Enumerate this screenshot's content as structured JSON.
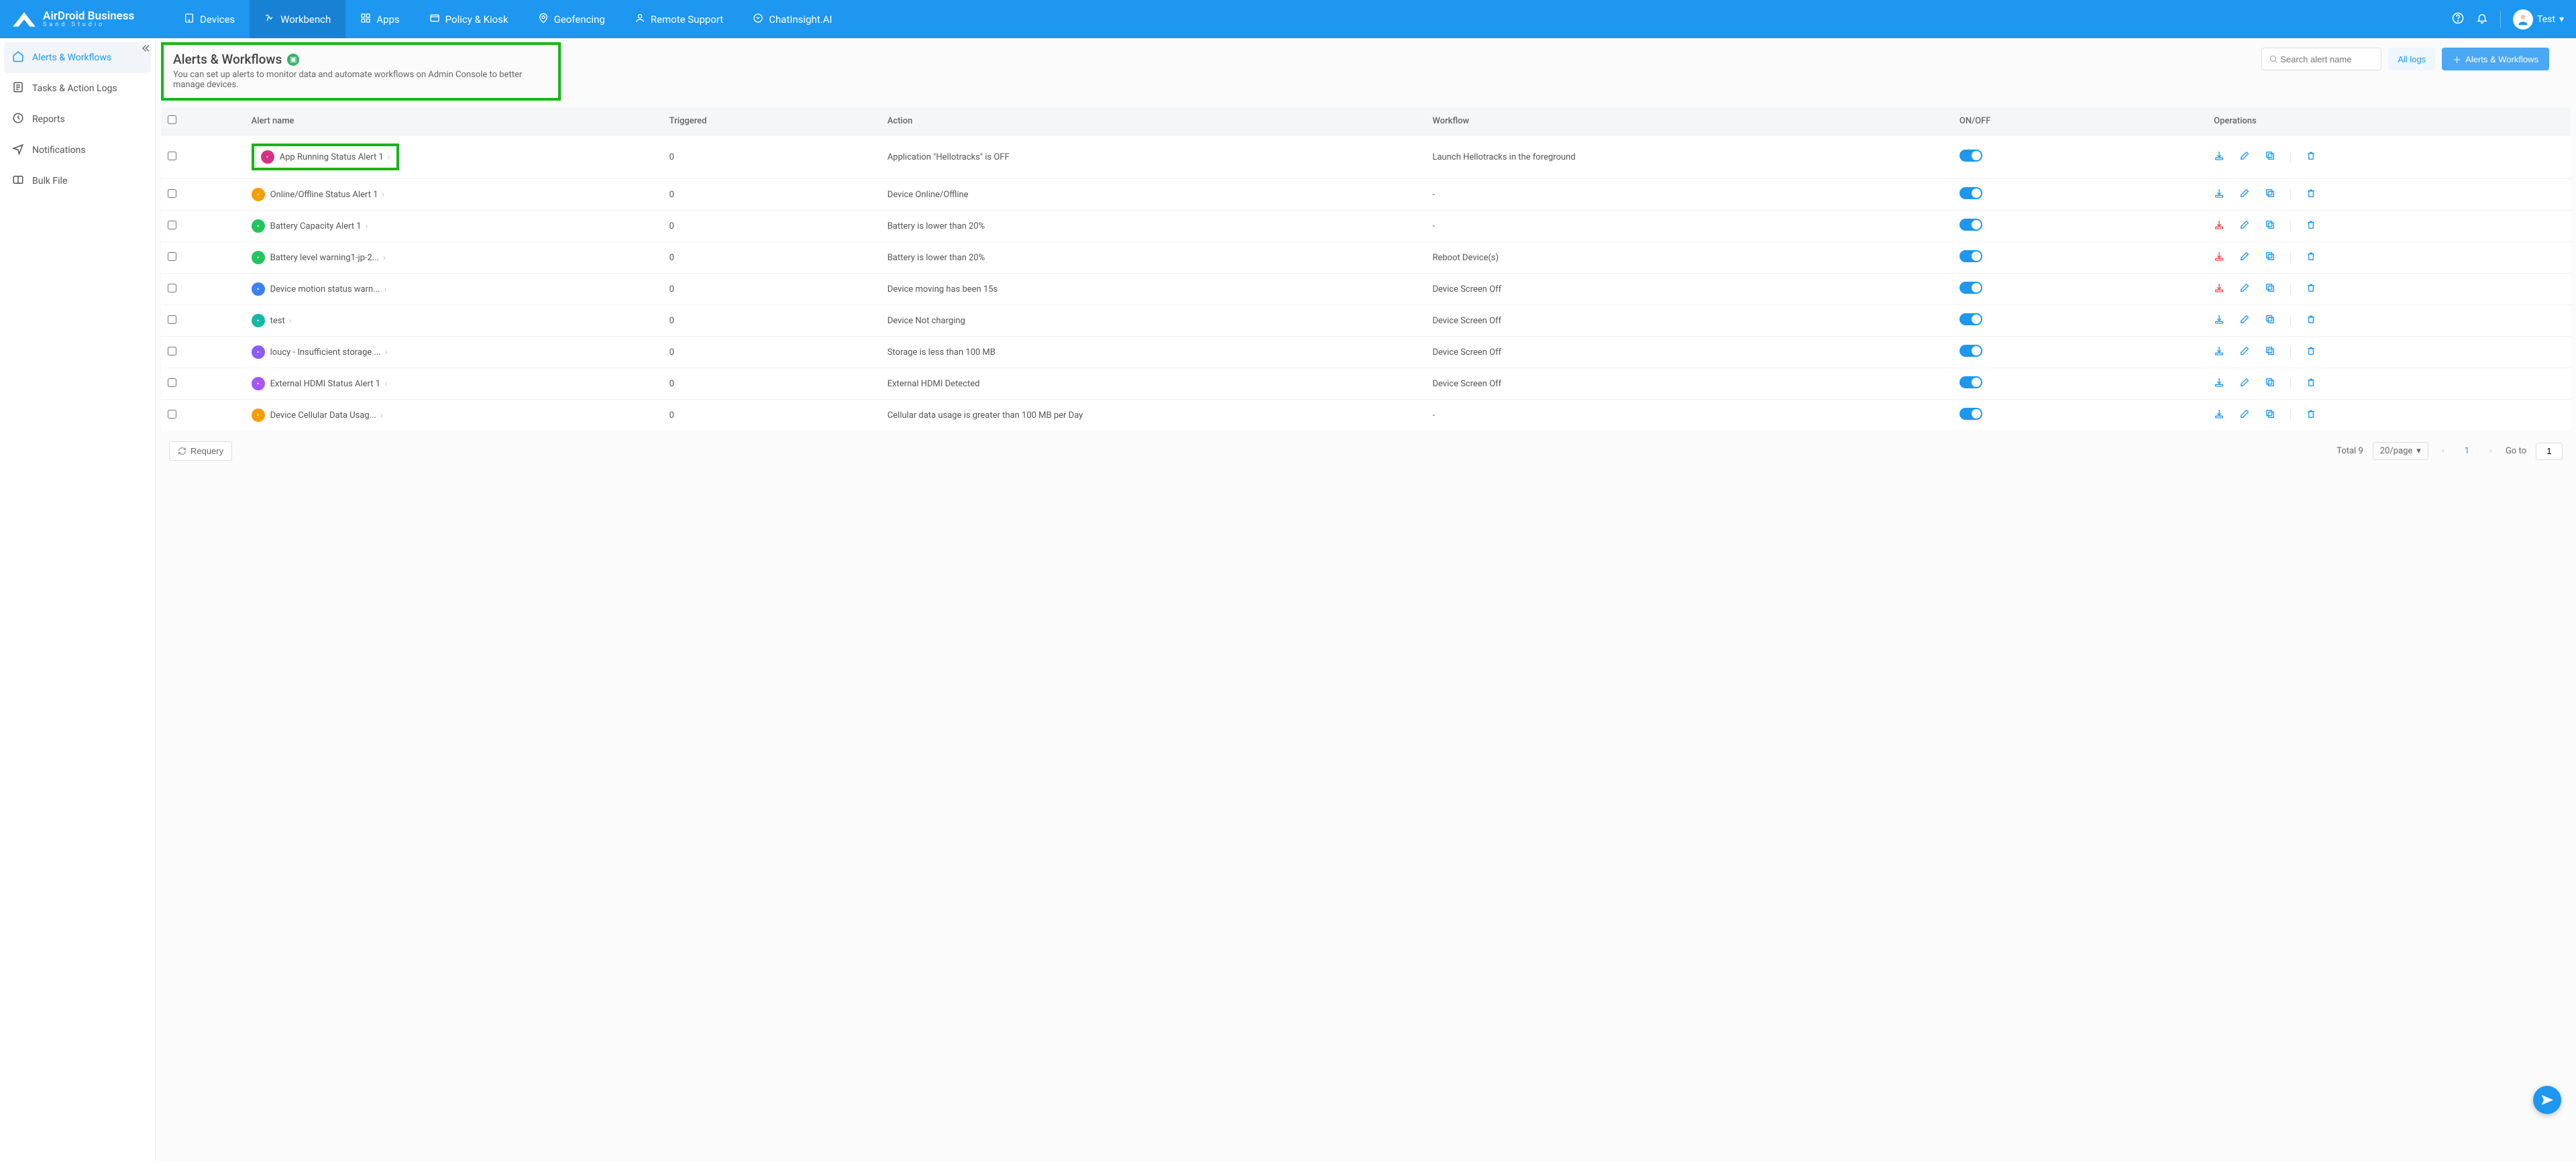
{
  "brand": {
    "name": "AirDroid Business",
    "sub": "Sand Studio"
  },
  "nav": [
    {
      "label": "Devices",
      "active": false
    },
    {
      "label": "Workbench",
      "active": true
    },
    {
      "label": "Apps",
      "active": false
    },
    {
      "label": "Policy & Kiosk",
      "active": false
    },
    {
      "label": "Geofencing",
      "active": false
    },
    {
      "label": "Remote Support",
      "active": false
    },
    {
      "label": "ChatInsight.AI",
      "active": false
    }
  ],
  "user": {
    "name": "Test"
  },
  "sidebar": [
    {
      "label": "Alerts & Workflows",
      "active": true
    },
    {
      "label": "Tasks & Action Logs",
      "active": false
    },
    {
      "label": "Reports",
      "active": false
    },
    {
      "label": "Notifications",
      "active": false
    },
    {
      "label": "Bulk File",
      "active": false
    }
  ],
  "page": {
    "title": "Alerts & Workflows",
    "subtitle": "You can set up alerts to monitor data and automate workflows on Admin Console to better manage devices.",
    "search_placeholder": "Search alert name",
    "all_logs_label": "All logs",
    "create_label": "Alerts & Workflows"
  },
  "columns": {
    "name": "Alert name",
    "triggered": "Triggered",
    "action": "Action",
    "workflow": "Workflow",
    "onoff": "ON/OFF",
    "operations": "Operations"
  },
  "rows": [
    {
      "color": "#d63384",
      "name": "App Running Status Alert 1",
      "triggered": 0,
      "action": "Application \"Hellotracks\" is OFF",
      "workflow": "Launch Hellotracks in the foreground",
      "on": true,
      "opColor": "#1d97f0",
      "highlight": true
    },
    {
      "color": "#f59e0b",
      "name": "Online/Offline Status Alert 1",
      "triggered": 0,
      "action": "Device Online/Offline",
      "workflow": "-",
      "on": true,
      "opColor": "#1d97f0"
    },
    {
      "color": "#22c55e",
      "name": "Battery Capacity Alert 1",
      "triggered": 0,
      "action": "Battery is lower than 20%",
      "workflow": "-",
      "on": true,
      "opColor": "#ef4444"
    },
    {
      "color": "#22c55e",
      "name": "Battery level warning1-jp-2...",
      "triggered": 0,
      "action": "Battery is lower than 20%",
      "workflow": "Reboot Device(s)",
      "on": true,
      "opColor": "#ef4444"
    },
    {
      "color": "#3b82f6",
      "name": "Device motion status warn...",
      "triggered": 0,
      "action": "Device moving has been 15s",
      "workflow": "Device Screen Off",
      "on": true,
      "opColor": "#ef4444"
    },
    {
      "color": "#14b8a6",
      "name": "test",
      "triggered": 0,
      "action": "Device Not charging",
      "workflow": "Device Screen Off",
      "on": true,
      "opColor": "#1d97f0"
    },
    {
      "color": "#8b5cf6",
      "name": "loucy - Insufficient storage ...",
      "triggered": 0,
      "action": "Storage is less than 100 MB",
      "workflow": "Device Screen Off",
      "on": true,
      "opColor": "#1d97f0"
    },
    {
      "color": "#a855f7",
      "name": "External HDMI Status Alert 1",
      "triggered": 0,
      "action": "External HDMI Detected",
      "workflow": "Device Screen Off",
      "on": true,
      "opColor": "#1d97f0"
    },
    {
      "color": "#f59e0b",
      "name": "Device Cellular Data Usag...",
      "triggered": 0,
      "action": "Cellular data usage is greater than 100 MB per Day",
      "workflow": "-",
      "on": true,
      "opColor": "#1d97f0"
    }
  ],
  "footer": {
    "requery": "Requery",
    "total_label": "Total 9",
    "per_page": "20/page",
    "current_page": "1",
    "goto_label": "Go to",
    "goto_value": "1"
  }
}
